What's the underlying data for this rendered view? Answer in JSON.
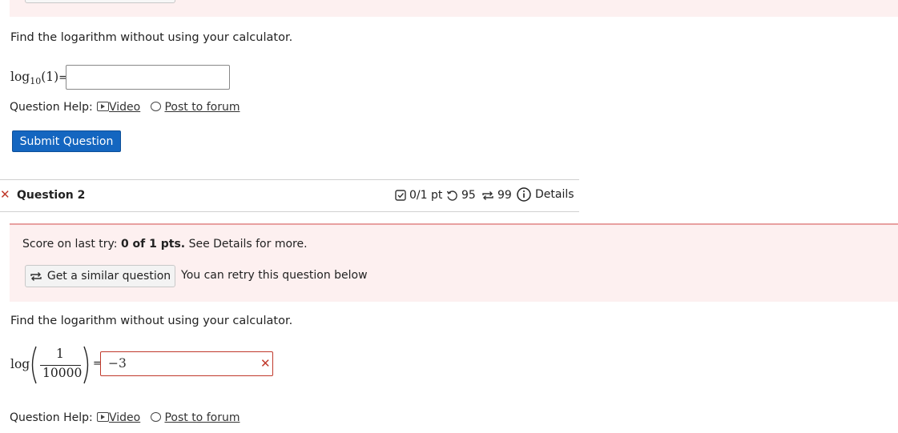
{
  "question1": {
    "instruction": "Find the logarithm without using your calculator.",
    "expression_log": "log",
    "expression_base": "10",
    "expression_arg": "(1)",
    "equals": "=",
    "answer_value": ""
  },
  "help": {
    "label": "Question Help:",
    "video": "Video",
    "forum": "Post to forum"
  },
  "submit_label": "Submit Question",
  "question2": {
    "title": "Question 2",
    "score": "0/1 pt",
    "retries": "95",
    "similar_count": "99",
    "details": "Details",
    "score_prefix": "Score on last try:",
    "score_bold": "0 of 1 pts.",
    "score_suffix": "See Details for more.",
    "similar_button": "Get a similar question",
    "retry_note": "You can retry this question below",
    "instruction": "Find the logarithm without using your calculator.",
    "expression_log": "log",
    "numerator": "1",
    "denominator": "10000",
    "equals": "=",
    "answer_value": "−3"
  },
  "colors": {
    "accent": "#1466c0",
    "error": "#c0392b",
    "band": "#fdf0f0"
  }
}
